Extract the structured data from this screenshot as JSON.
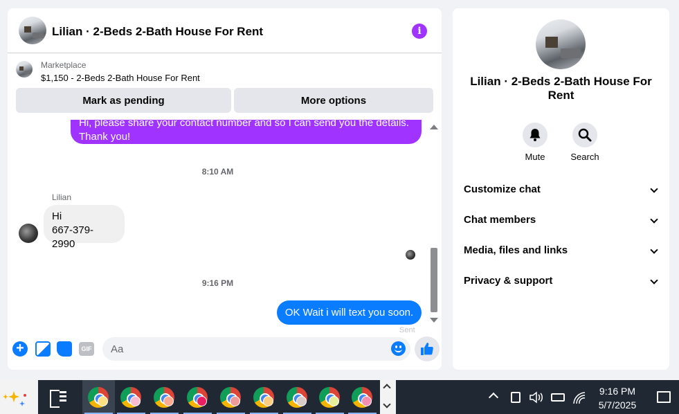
{
  "chat": {
    "title": "Lilian · 2-Beds 2-Bath House For Rent",
    "listing": {
      "label": "Marketplace",
      "title": "$1,150 - 2-Beds 2-Bath House For Rent",
      "pending_button": "Mark as pending",
      "more_button": "More options"
    },
    "messages": {
      "first_outgoing": "Hi, please share your contact number and so I can send you the details. Thank you!",
      "timestamp_1": "8:10 AM",
      "sender_name": "Lilian",
      "incoming_line_1": "Hi",
      "incoming_line_2": "667-379-2990",
      "timestamp_2": "9:16 PM",
      "last_outgoing": "OK Wait i will text you soon.",
      "sent_status": "Sent"
    },
    "composer": {
      "placeholder": "Aa",
      "gif_label": "GIF",
      "plus_glyph": "+"
    },
    "info_glyph": "i"
  },
  "info_panel": {
    "title": "Lilian · 2-Beds 2-Bath House For Rent",
    "actions": [
      {
        "label": "Mute",
        "icon": "bell-icon"
      },
      {
        "label": "Search",
        "icon": "search-icon"
      }
    ],
    "sections": [
      {
        "label": "Customize chat"
      },
      {
        "label": "Chat members"
      },
      {
        "label": "Media, files and links"
      },
      {
        "label": "Privacy & support"
      }
    ]
  },
  "taskbar": {
    "time": "9:16 PM",
    "date": "5/7/2025",
    "apps": [
      "chrome-icon",
      "chrome-icon",
      "chrome-icon",
      "chrome-icon",
      "chrome-icon",
      "chrome-icon",
      "chrome-icon",
      "chrome-icon",
      "chrome-icon"
    ]
  },
  "colors": {
    "accent_blue": "#0a7cff",
    "accent_purple": "#a033ff",
    "panel_bg": "#ffffff",
    "page_bg": "#f0f2f5"
  }
}
